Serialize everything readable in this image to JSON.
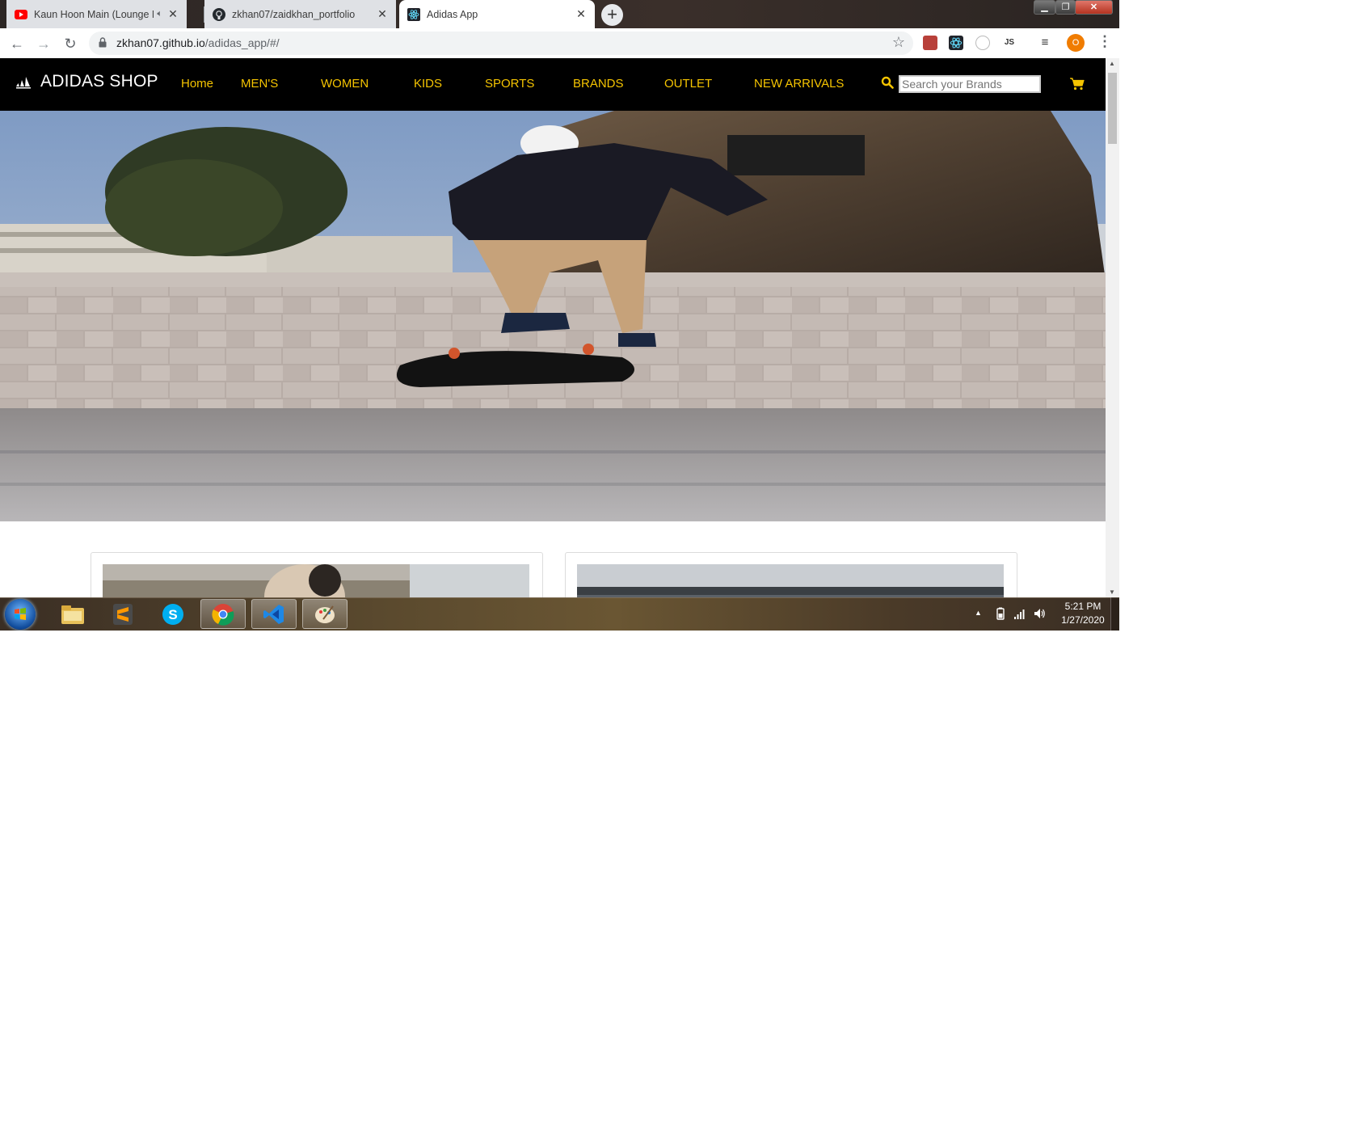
{
  "browser": {
    "tabs": [
      {
        "title": "Kaun Hoon Main (Lounge M",
        "icon": "youtube-icon",
        "audio": true
      },
      {
        "title": "zkhan07/zaidkhan_portfolio",
        "icon": "github-icon"
      },
      {
        "title": "Adidas App",
        "icon": "react-icon",
        "active": true
      }
    ],
    "new_tab_label": "+",
    "url_host": "zkhan07.github.io",
    "url_path": "/adidas_app/#/",
    "profile_initial": "O",
    "extensions": [
      "pdf-icon",
      "react-devtools-icon",
      "clock-ext-icon",
      "node-js-icon",
      "media-controls-icon"
    ]
  },
  "site": {
    "brand": "ADIDAS SHOP",
    "nav": [
      "Home",
      "MEN'S",
      "WOMEN",
      "KIDS",
      "SPORTS",
      "BRANDS",
      "OUTLET",
      "NEW ARRIVALS"
    ],
    "search_placeholder": "Search your Brands",
    "accent_color": "#f5c400",
    "nav_background": "#000000"
  },
  "taskbar": {
    "apps": [
      "file-explorer-icon",
      "sublime-text-icon",
      "skype-icon",
      "chrome-icon",
      "vscode-icon",
      "paint-icon"
    ],
    "time": "5:21 PM",
    "date": "1/27/2020"
  }
}
